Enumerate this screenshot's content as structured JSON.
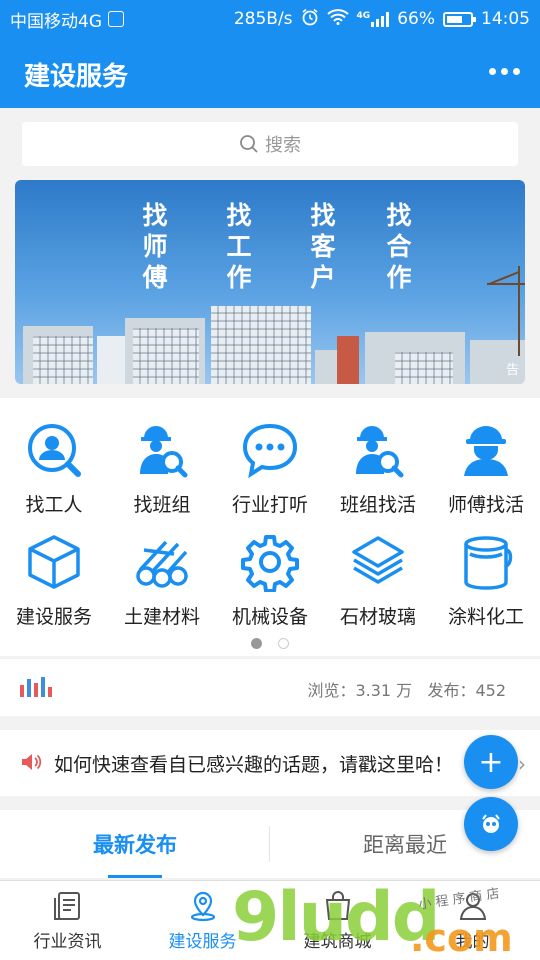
{
  "status_bar": {
    "carrier": "中国移动4G",
    "speed": "285B/s",
    "net_label": "4G",
    "battery": "66%",
    "time": "14:05"
  },
  "header": {
    "title": "建设服务"
  },
  "search": {
    "placeholder": "搜索"
  },
  "banner": {
    "columns": [
      "找师傅",
      "找工作",
      "找客户",
      "找合作"
    ],
    "tag": "告"
  },
  "grid": {
    "items": [
      {
        "label": "找工人",
        "icon": "person-search-icon"
      },
      {
        "label": "找班组",
        "icon": "worker-search-icon"
      },
      {
        "label": "行业打听",
        "icon": "chat-bubble-icon"
      },
      {
        "label": "班组找活",
        "icon": "worker-search-icon"
      },
      {
        "label": "师傅找活",
        "icon": "hardhat-worker-icon"
      },
      {
        "label": "建设服务",
        "icon": "cube-icon"
      },
      {
        "label": "土建材料",
        "icon": "pipes-icon"
      },
      {
        "label": "机械设备",
        "icon": "gear-icon"
      },
      {
        "label": "石材玻璃",
        "icon": "layers-icon"
      },
      {
        "label": "涂料化工",
        "icon": "paint-bucket-icon"
      }
    ],
    "page_indicator": {
      "current": 1,
      "total": 2
    }
  },
  "stats": {
    "views": "浏览：3.31 万",
    "posts": "发布：452"
  },
  "notice": {
    "message": "如何快速查看自已感兴趣的话题，请戳这里哈！"
  },
  "tabs": {
    "latest": "最新发布",
    "nearest": "距离最近"
  },
  "fab": {
    "add_label": "+"
  },
  "nav": {
    "items": [
      {
        "label": "行业资讯",
        "icon": "news-icon"
      },
      {
        "label": "建设服务",
        "icon": "location-icon"
      },
      {
        "label": "建筑商城",
        "icon": "shopping-bag-icon"
      },
      {
        "label": "我的",
        "icon": "user-icon"
      }
    ],
    "active_index": 1
  },
  "watermark": {
    "main": "9ludd",
    "domain": ".com",
    "tagline": "小 程 序 商 店"
  },
  "colors": {
    "primary": "#1a8ff2",
    "watermark_green": "#8bcf3a",
    "watermark_orange": "#f39a1e"
  }
}
